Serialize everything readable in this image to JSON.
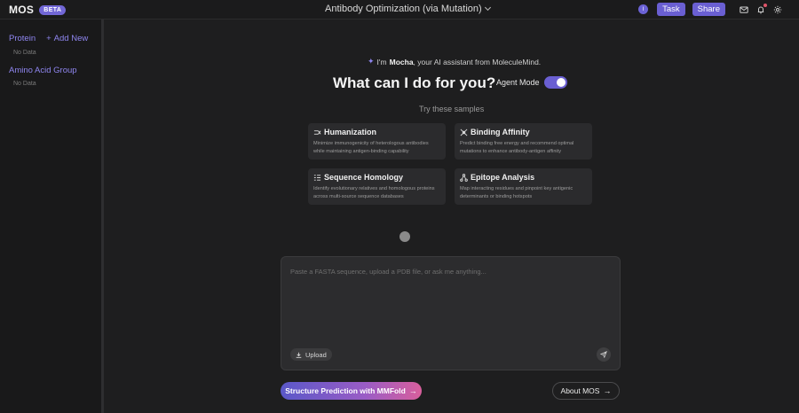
{
  "app": {
    "name": "MOS",
    "badge": "BETA"
  },
  "header": {
    "title": "Antibody Optimization (via Mutation)",
    "user_initial": "I",
    "task_label": "Task",
    "share_label": "Share"
  },
  "sidebar": {
    "protein_label": "Protein",
    "add_new_label": "Add New",
    "protein_empty": "No Data",
    "amino_label": "Amino Acid Group",
    "amino_empty": "No Data"
  },
  "main": {
    "assistant_prefix": "I'm",
    "assistant_name": "Mocha",
    "assistant_suffix": ", your AI assistant from MoleculeMind.",
    "hero": "What can I do for you?",
    "agent_mode_label": "Agent Mode",
    "agent_mode_on": true,
    "samples_label": "Try these samples",
    "samples": [
      {
        "title": "Humanization",
        "desc": "Minimize immunogenicity of heterologous antibodies while maintaining antigen-binding capability"
      },
      {
        "title": "Binding Affinity",
        "desc": "Predict binding free energy and recommend optimal mutations to enhance antibody-antigen affinity"
      },
      {
        "title": "Sequence Homology",
        "desc": "Identify evolutionary relatives and homologous proteins across multi-source sequence databases"
      },
      {
        "title": "Epitope Analysis",
        "desc": "Map interacting residues and pinpoint key antigenic determinants or binding hotspots"
      }
    ],
    "composer": {
      "placeholder": "Paste a FASTA sequence, upload a PDB file, or ask me anything...",
      "upload_label": "Upload"
    },
    "structure_button": "Structure Prediction with MMFold",
    "about_button": "About MOS"
  },
  "colors": {
    "accent": "#6a5fd2",
    "background": "#1e1e1f",
    "card": "#2b2b2d"
  }
}
